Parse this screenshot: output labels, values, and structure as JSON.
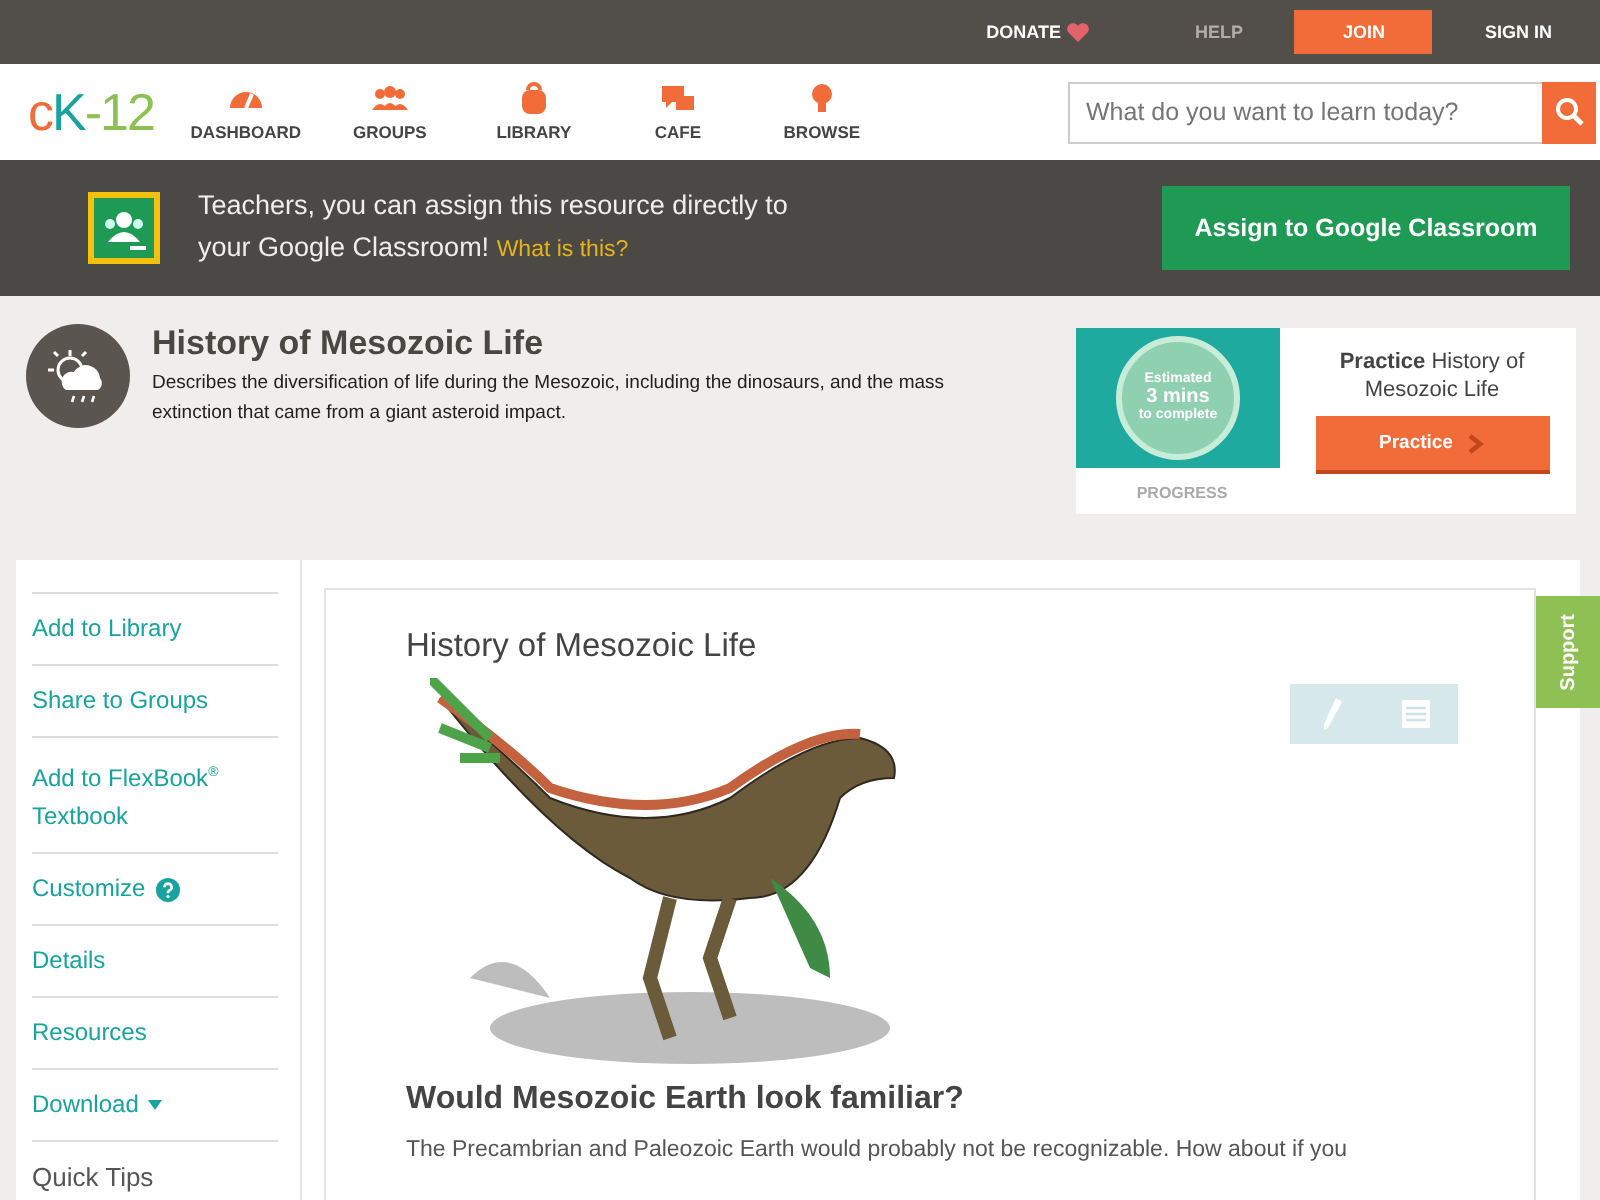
{
  "top_bar": {
    "links": [
      {
        "label": "DONATE",
        "kind": "donate"
      },
      {
        "label": "HELP",
        "kind": "muted"
      },
      {
        "label": "JOIN",
        "kind": "primary"
      },
      {
        "label": "SIGN IN",
        "kind": "plain"
      }
    ]
  },
  "nav": {
    "logo": {
      "c": "c",
      "k": "K",
      "rest": "-12"
    },
    "items": [
      {
        "label": "DASHBOARD"
      },
      {
        "label": "GROUPS"
      },
      {
        "label": "LIBRARY"
      },
      {
        "label": "CAFE"
      },
      {
        "label": "BROWSE"
      }
    ],
    "search": {
      "placeholder": "What do you want to learn today?"
    }
  },
  "classroom_banner": {
    "text": "Teachers, you can assign this resource directly to your Google Classroom!",
    "link": "What is this?",
    "button": "Assign to Google Classroom"
  },
  "header": {
    "title": "History of Mesozoic Life",
    "description": "Describes the diversification of life during the Mesozoic, including the dinosaurs, and the mass extinction that came from a giant asteroid impact.",
    "practice_card": {
      "estimate_lines": [
        "Estimated",
        "3 mins",
        "to complete"
      ],
      "progress_label": "PROGRESS",
      "heading_bold": "Practice",
      "heading_rest": "History of Mesozoic Life",
      "button": "Practice"
    }
  },
  "sidebar": {
    "items": [
      {
        "label": "Add to Library",
        "kind": "link"
      },
      {
        "label": "Share to Groups",
        "kind": "link"
      },
      {
        "label": "Add to FlexBook$^{®}$ Textbook",
        "kind": "link"
      },
      {
        "label": "Customize",
        "kind": "help"
      },
      {
        "label": "Details",
        "kind": "link"
      },
      {
        "label": "Resources",
        "kind": "link"
      },
      {
        "label": "Download",
        "kind": "dropdown"
      },
      {
        "label": "Quick Tips",
        "kind": "heading"
      }
    ]
  },
  "article": {
    "title": "History of Mesozoic Life",
    "heading": "Would Mesozoic Earth look familiar?",
    "paragraph": "The Precambrian and Paleozoic Earth would probably not be recognizable. How about if you"
  },
  "support_tab": {
    "label": "Support"
  }
}
